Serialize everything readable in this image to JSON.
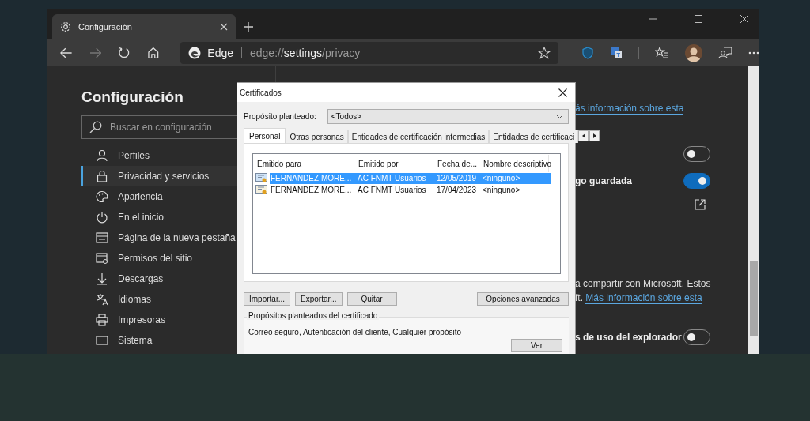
{
  "browser": {
    "tab": {
      "title": "Configuración",
      "selected": true
    },
    "forward_disabled": true,
    "address": {
      "brand": "Edge",
      "url": "edge://**settings**/privacy"
    }
  },
  "sidebar": {
    "title": "Configuración",
    "search_placeholder": "Buscar en configuración",
    "items": [
      {
        "label": "Perfiles",
        "selected": false
      },
      {
        "label": "Privacidad y servicios",
        "selected": true
      },
      {
        "label": "Apariencia",
        "selected": false
      },
      {
        "label": "En el inicio",
        "selected": false
      },
      {
        "label": "Página de la nueva pestaña",
        "selected": false
      },
      {
        "label": "Permisos del sitio",
        "selected": false
      },
      {
        "label": "Descargas",
        "selected": false
      },
      {
        "label": "Idiomas",
        "selected": false
      },
      {
        "label": "Impresoras",
        "selected": false
      },
      {
        "label": "Sistema",
        "selected": false
      }
    ]
  },
  "content": {
    "rows": [
      {
        "kind": "link",
        "text": "ás información sobre esta"
      },
      {
        "kind": "toggle",
        "on": false
      },
      {
        "kind": "toggle",
        "label": "go guardada",
        "on": true
      },
      {
        "kind": "external"
      },
      {
        "kind": "text",
        "text": "a compartir con Microsoft. Estos"
      },
      {
        "kind": "text",
        "text": "ft.",
        "link": "Más información sobre esta"
      },
      {
        "kind": "toggle",
        "label": "s de uso del explorador",
        "on": false
      }
    ]
  },
  "dialog": {
    "title": "Certificados",
    "purpose_label": "Propósito planteado:",
    "purpose_value": "<Todos>",
    "tabs": [
      {
        "label": "Personal",
        "selected": true
      },
      {
        "label": "Otras personas",
        "selected": false
      },
      {
        "label": "Entidades de certificación intermedias",
        "selected": false
      },
      {
        "label": "Entidades de certificaci",
        "selected": false
      }
    ],
    "columns": [
      "Emitido para",
      "Emitido por",
      "Fecha de...",
      "Nombre descriptivo"
    ],
    "rows": [
      {
        "cells": [
          "FERNANDEZ MORE...",
          "AC FNMT Usuarios",
          "12/05/2019",
          "<ninguno>"
        ],
        "selected": true
      },
      {
        "cells": [
          "FERNANDEZ MORE...",
          "AC FNMT Usuarios",
          "17/04/2023",
          "<ninguno>"
        ],
        "selected": false
      }
    ],
    "buttons": [
      "Importar...",
      "Exportar...",
      "Quitar"
    ],
    "advanced_button": "Opciones avanzadas",
    "purposes_title": "Propósitos planteados del certificado",
    "purposes_text": "Correo seguro, Autenticación del cliente, Cualquier propósito",
    "view_button": "Ver"
  }
}
